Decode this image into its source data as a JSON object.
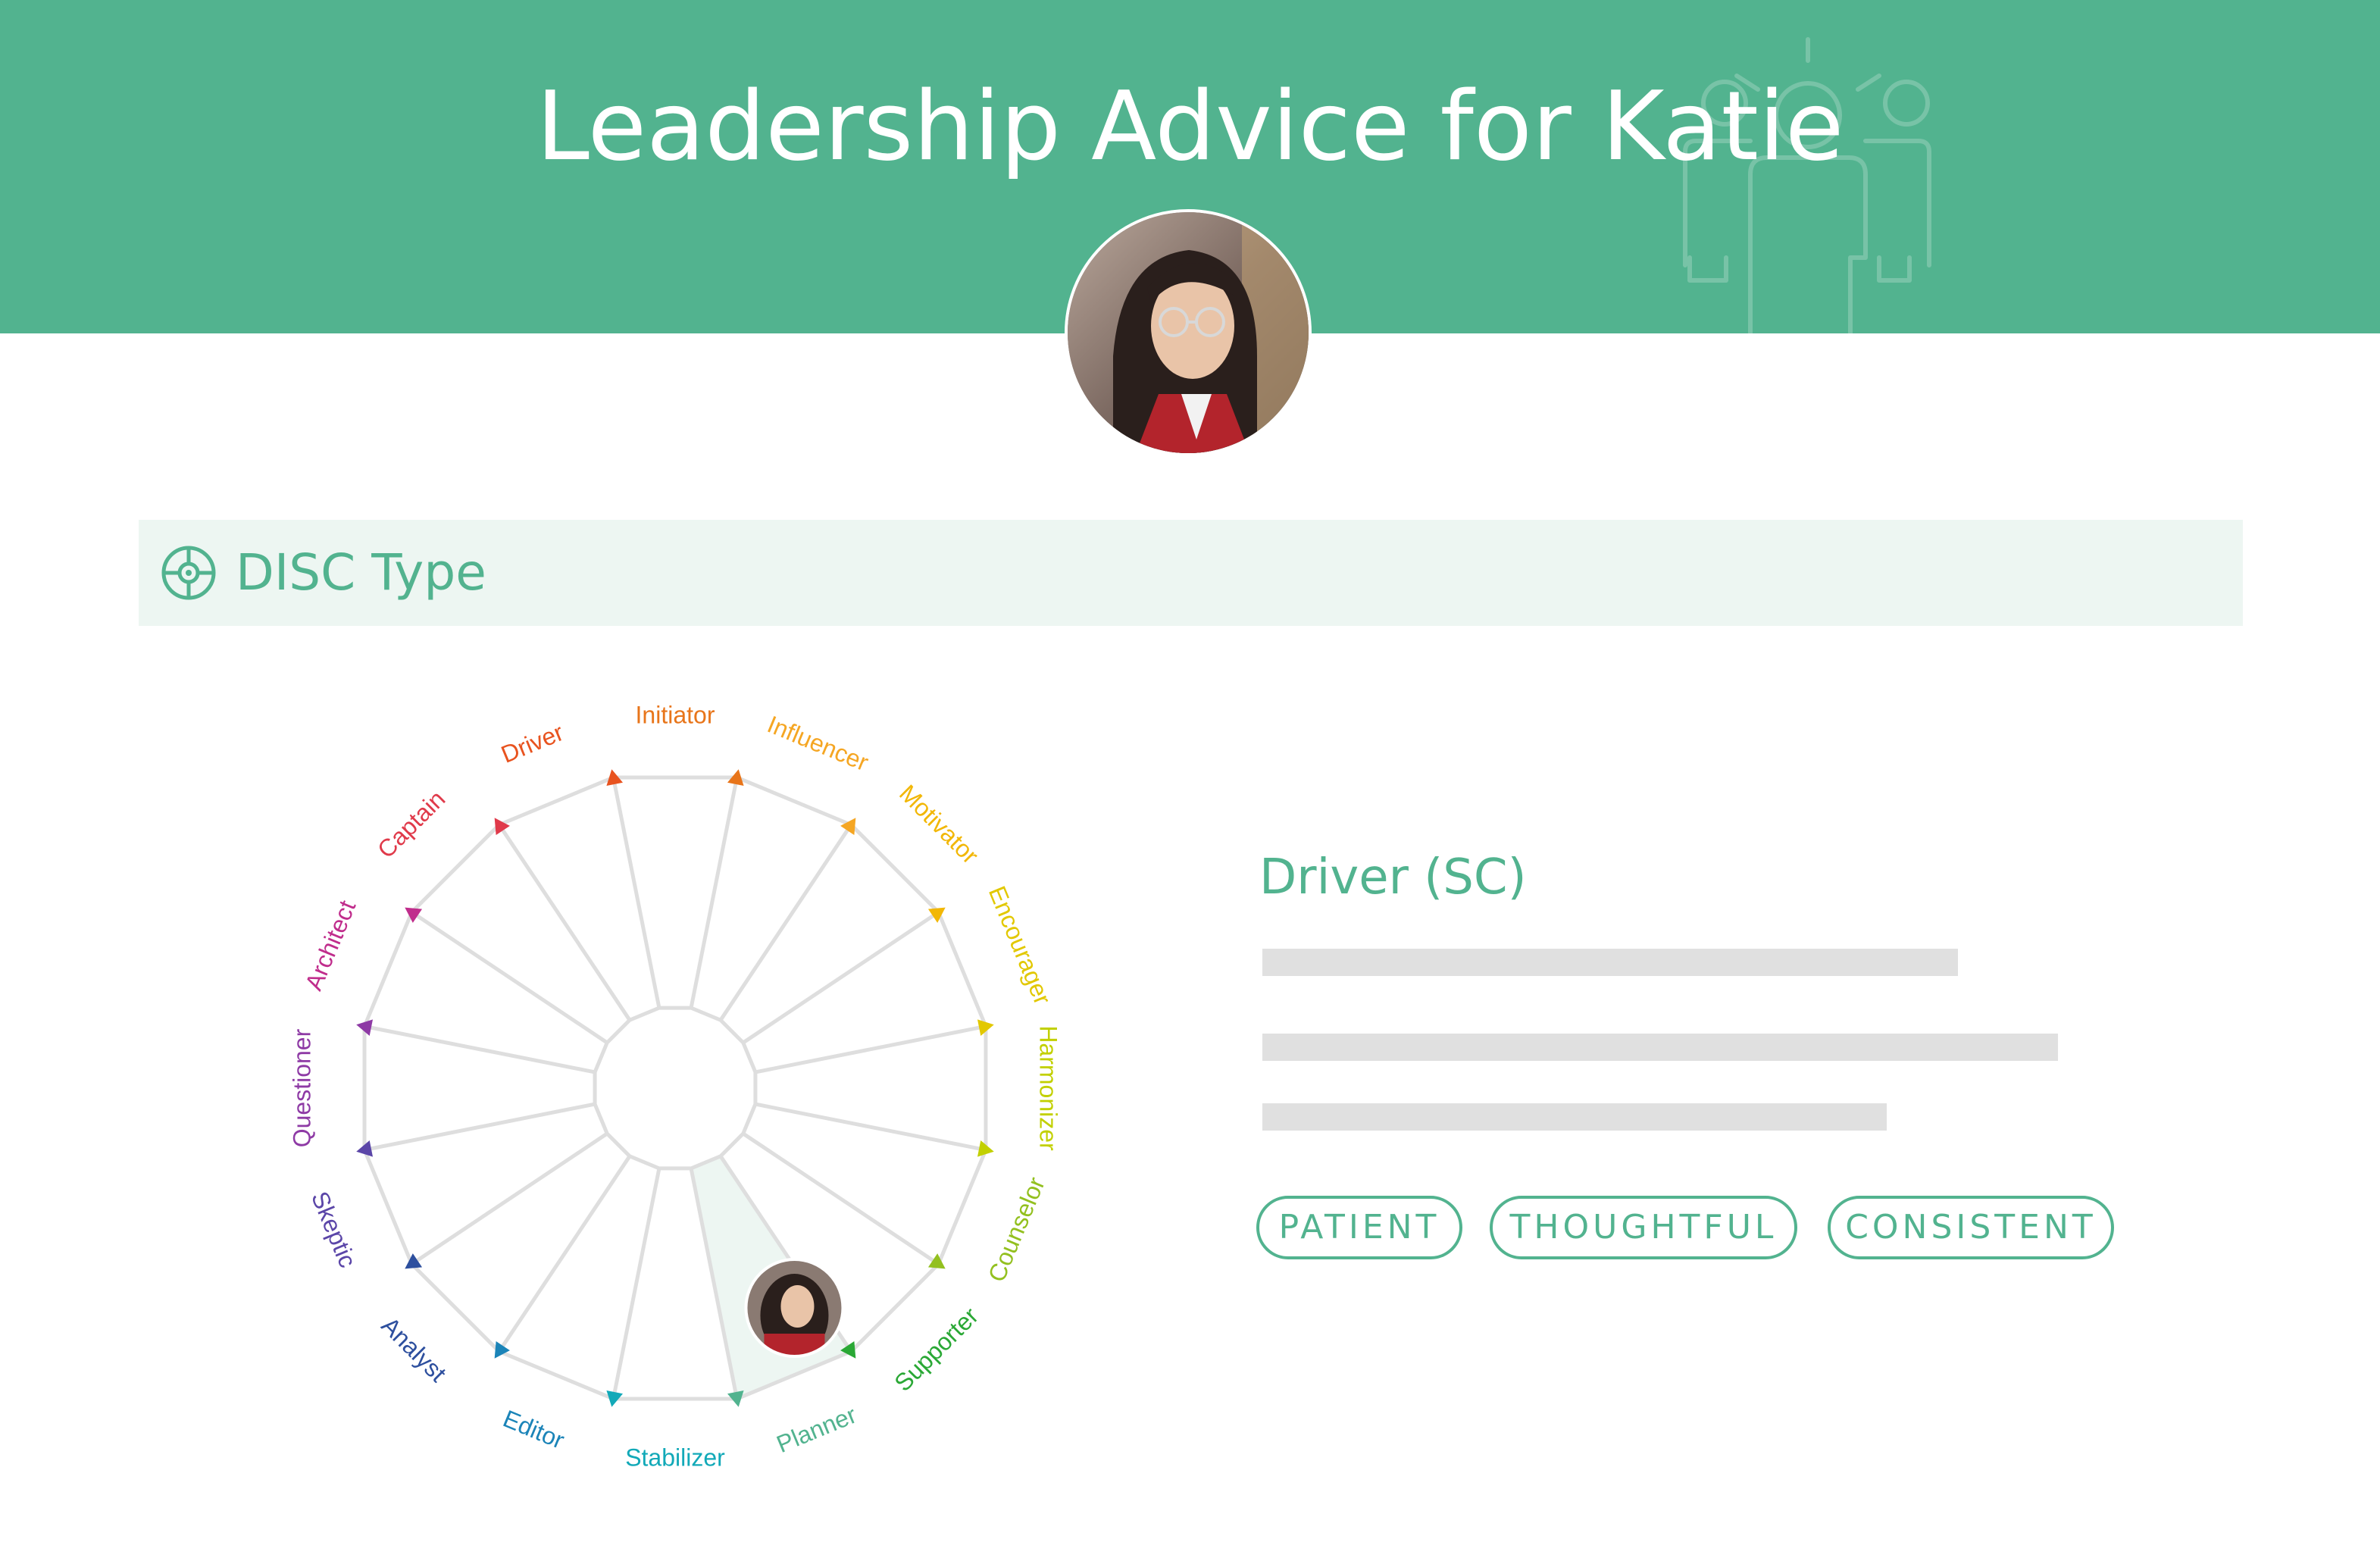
{
  "header": {
    "title": "Leadership Advice for Katie",
    "background_color": "#52b38f"
  },
  "profile": {
    "avatar_icon": "person-photo"
  },
  "section": {
    "title": "DISC Type",
    "icon": "compass-icon"
  },
  "disc_wheel": {
    "segments": [
      {
        "label": "Initiator",
        "color": "#e8751a"
      },
      {
        "label": "Influencer",
        "color": "#f5a623"
      },
      {
        "label": "Motivator",
        "color": "#f2b705"
      },
      {
        "label": "Encourager",
        "color": "#e2c800"
      },
      {
        "label": "Harmonizer",
        "color": "#c2d000"
      },
      {
        "label": "Counselor",
        "color": "#93c01f"
      },
      {
        "label": "Supporter",
        "color": "#2aa835"
      },
      {
        "label": "Planner",
        "color": "#52b38f"
      },
      {
        "label": "Stabilizer",
        "color": "#12a9b8"
      },
      {
        "label": "Editor",
        "color": "#1b84b8"
      },
      {
        "label": "Analyst",
        "color": "#2d4f9e"
      },
      {
        "label": "Skeptic",
        "color": "#5b46a8"
      },
      {
        "label": "Questioner",
        "color": "#8e3aa5"
      },
      {
        "label": "Architect",
        "color": "#c02d8c"
      },
      {
        "label": "Captain",
        "color": "#e03a4a"
      },
      {
        "label": "Driver",
        "color": "#e8531f"
      }
    ],
    "highlighted_segment": "Planner",
    "highlight_color": "#edf6f2"
  },
  "result": {
    "title": "Driver (SC)",
    "tags": [
      "PATIENT",
      "THOUGHTFUL",
      "CONSISTENT"
    ]
  }
}
